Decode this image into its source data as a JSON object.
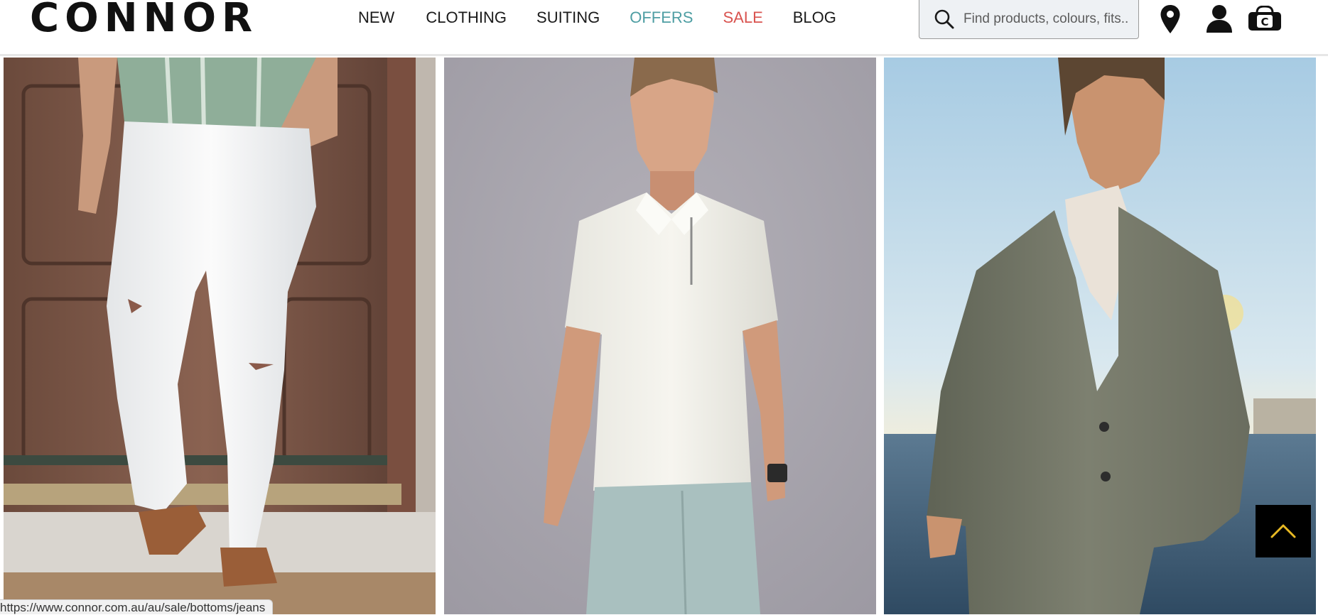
{
  "brand": {
    "logo_text": "CONNOR"
  },
  "nav": {
    "items": [
      {
        "label": "NEW"
      },
      {
        "label": "CLOTHING"
      },
      {
        "label": "SUITING"
      },
      {
        "label": "OFFERS"
      },
      {
        "label": "SALE"
      },
      {
        "label": "BLOG"
      }
    ]
  },
  "search": {
    "placeholder": "Find products, colours, fits.."
  },
  "header_icons": [
    "location-pin-icon",
    "account-icon",
    "bag-icon"
  ],
  "products": [
    {
      "image": "model-white-jeans-photo"
    },
    {
      "image": "model-white-zip-polo-photo"
    },
    {
      "image": "model-grey-suit-beach-photo"
    }
  ],
  "scroll_top": {
    "icon": "chevron-up-icon",
    "color": "#e8b923"
  },
  "status_bar": {
    "url": "https://www.connor.com.au/au/sale/bottoms/jeans"
  },
  "colors": {
    "offers": "#4e9ea3",
    "sale": "#d9534f",
    "text": "#1a1a1a"
  }
}
